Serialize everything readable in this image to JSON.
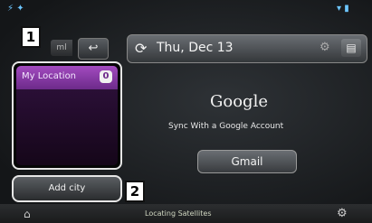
{
  "statusbar": {
    "left_icons": "⚡ ✦",
    "right_icons": "▾ ▮"
  },
  "small_tab": {
    "label": "ml"
  },
  "toolbar": {
    "back_glyph": "↩"
  },
  "date_bar": {
    "date": "Thu, Dec 13",
    "refresh_glyph": "⟳",
    "settings_glyph": "⚙",
    "calendar_glyph": "▤"
  },
  "city_panel": {
    "location_label": "My Location",
    "location_badge": "0"
  },
  "add_city": {
    "label": "Add city"
  },
  "callouts": {
    "one": "1",
    "two": "2"
  },
  "google": {
    "logo": "Google",
    "sync_text": "Sync With a Google Account",
    "gmail_label": "Gmail"
  },
  "bottombar": {
    "status": "Locating Satellites",
    "home_glyph": "⌂",
    "settings_glyph": "⚙"
  },
  "colors": {
    "accent": "#6dc6ff",
    "location_purple": "#a24bbf"
  }
}
